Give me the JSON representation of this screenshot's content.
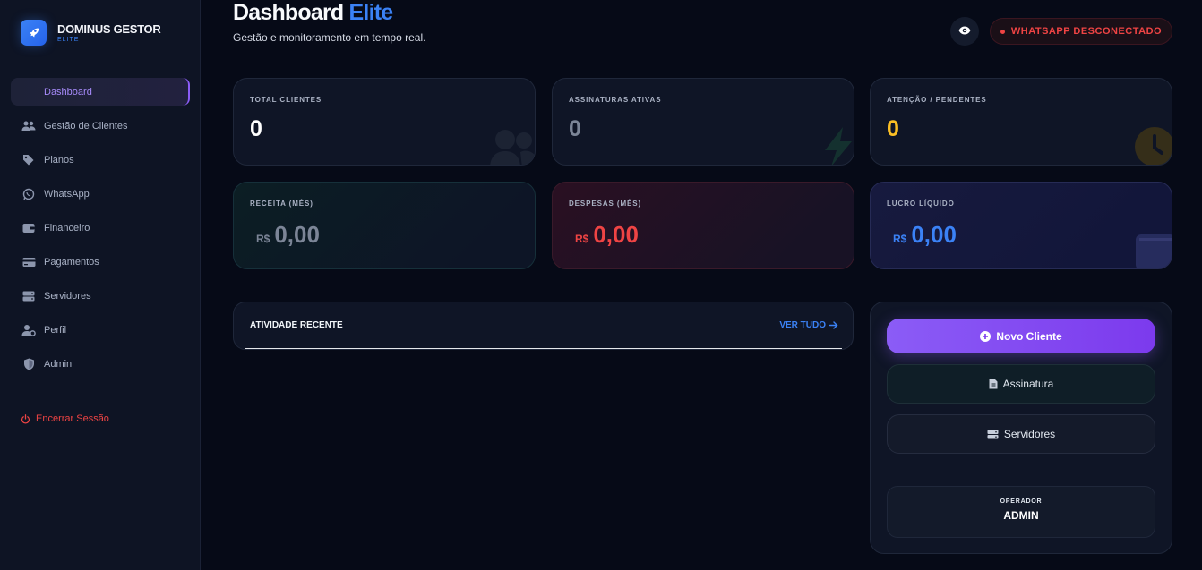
{
  "brand": {
    "name": "DOMINUS GESTOR",
    "sub": "ELITE",
    "icon": "rocket-icon"
  },
  "nav": [
    {
      "label": "Dashboard",
      "icon": "none",
      "active": true
    },
    {
      "label": "Gestão de Clientes",
      "icon": "users-icon"
    },
    {
      "label": "Planos",
      "icon": "tags-icon"
    },
    {
      "label": "WhatsApp",
      "icon": "whatsapp-icon"
    },
    {
      "label": "Financeiro",
      "icon": "wallet-icon"
    },
    {
      "label": "Pagamentos",
      "icon": "credit-card-icon"
    },
    {
      "label": "Servidores",
      "icon": "server-icon"
    },
    {
      "label": "Perfil",
      "icon": "user-gear-icon"
    },
    {
      "label": "Admin",
      "icon": "shield-icon"
    }
  ],
  "logout_label": "Encerrar Sessão",
  "header": {
    "title": "Dashboard",
    "title_accent": "Elite",
    "subtitle": "Gestão e monitoramento em tempo real.",
    "whatsapp_status": "WHATSAPP DESCONECTADO"
  },
  "stats": {
    "total_clientes": {
      "label": "TOTAL CLIENTES",
      "value": "0"
    },
    "assinaturas": {
      "label": "ASSINATURAS ATIVAS",
      "value": "0"
    },
    "pendentes": {
      "label": "ATENÇÃO / PENDENTES",
      "value": "0"
    },
    "receita": {
      "label": "RECEITA (MÊS)",
      "currency": "R$",
      "value": "0,00"
    },
    "despesas": {
      "label": "DESPESAS (MÊS)",
      "currency": "R$",
      "value": "0,00"
    },
    "lucro": {
      "label": "LUCRO LÍQUIDO",
      "currency": "R$",
      "value": "0,00"
    }
  },
  "activity": {
    "title": "ATIVIDADE RECENTE",
    "link": "VER TUDO"
  },
  "actions": {
    "new_client": "Novo Cliente",
    "subscription": "Assinatura",
    "servers": "Servidores"
  },
  "operator": {
    "label": "OPERADOR",
    "name": "ADMIN"
  },
  "colors": {
    "accent_blue": "#3b82f6",
    "accent_purple": "#8b5cf6",
    "danger": "#ef4444",
    "warning": "#fbbf24"
  }
}
